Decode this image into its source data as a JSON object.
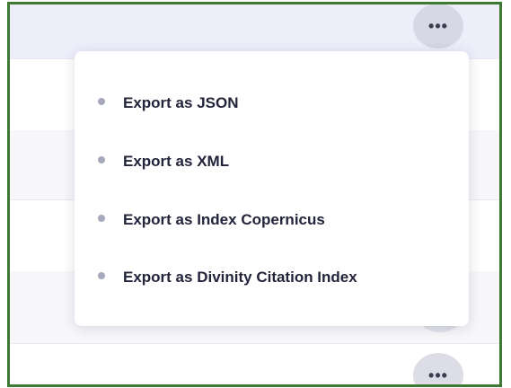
{
  "more_button": {
    "icon": "more-horizontal-icon",
    "glyph": "•••"
  },
  "export_menu": {
    "items": [
      {
        "label": "Export as JSON"
      },
      {
        "label": "Export as XML"
      },
      {
        "label": "Export as Index Copernicus"
      },
      {
        "label": "Export as Divinity Citation Index"
      }
    ]
  },
  "colors": {
    "border": "#3f7a34",
    "row_highlight": "#eeeefb",
    "bullet": "#a6a8bc",
    "menu_text": "#23243a"
  }
}
